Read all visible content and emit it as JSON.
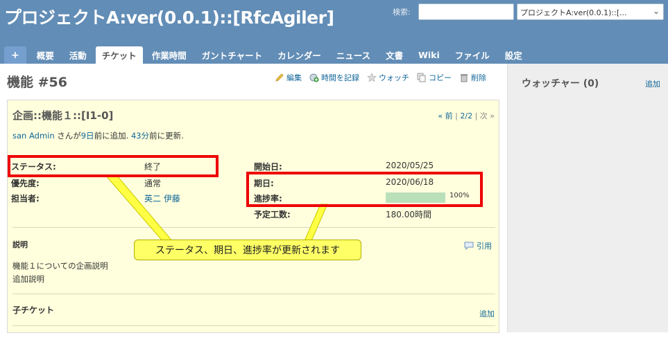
{
  "header": {
    "project_title": "プロジェクトA:ver(0.0.1)::[RfcAgiler]",
    "search_label": "検索:",
    "search_value": "",
    "project_select": "プロジェクトA:ver(0.0.1)::[..."
  },
  "menu": {
    "plus": "+",
    "tabs": [
      "概要",
      "活動",
      "チケット",
      "作業時間",
      "ガントチャート",
      "カレンダー",
      "ニュース",
      "文書",
      "Wiki",
      "ファイル",
      "設定"
    ],
    "selected": "チケット"
  },
  "page": {
    "heading": "機能 #56",
    "actions": {
      "edit": "編集",
      "log_time": "時間を記録",
      "watch": "ウォッチ",
      "copy": "コピー",
      "delete": "削除"
    }
  },
  "issue": {
    "subject": "企画::機能１::[I1-0]",
    "nav": {
      "prev": "« 前",
      "position": "2/2",
      "next": "次 »"
    },
    "author_link": "san Admin",
    "author_mid": " さんが",
    "created_ago": "9日",
    "created_suffix": "前に追加.",
    "updated_ago": "43分",
    "updated_suffix": "前に更新.",
    "attributes": {
      "status_label": "ステータス:",
      "status_value": "終了",
      "priority_label": "優先度:",
      "priority_value": "通常",
      "assignee_label": "担当者:",
      "assignee_value": "英二 伊藤",
      "start_label": "開始日:",
      "start_value": "2020/05/25",
      "due_label": "期日:",
      "due_value": "2020/06/18",
      "progress_label": "進捗率:",
      "progress_value": 1.0,
      "progress_text": "100%",
      "estimate_label": "予定工数:",
      "estimate_value": "180.00時間"
    },
    "description": {
      "title": "説明",
      "quote": "引用",
      "line1": "機能１についての企画説明",
      "line2": "追加説明"
    },
    "subtasks": {
      "title": "子チケット",
      "add": "追加"
    }
  },
  "sidebar": {
    "title": "ウォッチャー (0)",
    "add": "追加"
  },
  "annotation": {
    "callout": "ステータス、期日、進捗率が更新されます"
  },
  "colors": {
    "header": "#628db6",
    "issue_bg": "#ffffdd",
    "progress_fill": "#bae0ba",
    "highlight": "#ee0000",
    "callout": "#ffff66",
    "link": "#116699"
  }
}
